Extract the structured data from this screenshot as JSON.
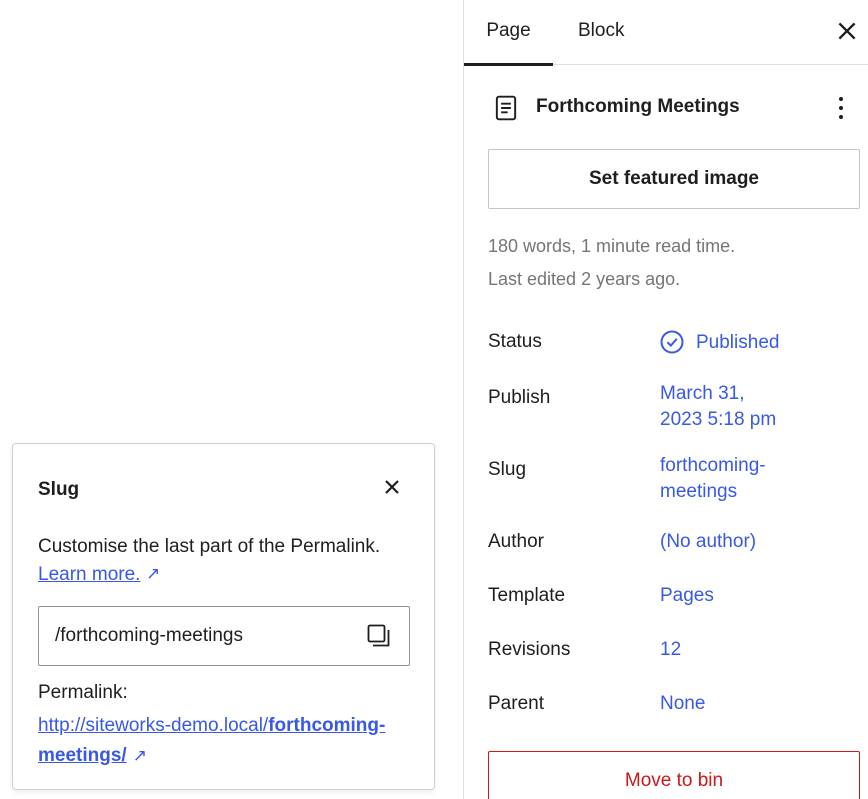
{
  "sidebar": {
    "tabs": [
      {
        "label": "Page",
        "active": true
      },
      {
        "label": "Block",
        "active": false
      }
    ],
    "close_icon": "close-icon",
    "page_title": "Forthcoming Meetings",
    "page_icon": "document-icon",
    "more_icon": "more-vertical-icon",
    "featured_image_label": "Set featured image",
    "word_count_text": "180 words, 1 minute read time.",
    "last_edited_text": "Last edited 2 years ago.",
    "rows": {
      "status": {
        "label": "Status",
        "value": "Published",
        "icon": "published-check-icon"
      },
      "publish": {
        "label": "Publish",
        "value_line1": "March 31,",
        "value_line2": "2023 5:18 pm"
      },
      "slug": {
        "label": "Slug",
        "value_line1": "forthcoming-",
        "value_line2": "meetings"
      },
      "author": {
        "label": "Author",
        "value": "(No author)"
      },
      "template": {
        "label": "Template",
        "value": "Pages"
      },
      "revisions": {
        "label": "Revisions",
        "value": "12"
      },
      "parent": {
        "label": "Parent",
        "value": "None"
      }
    },
    "move_to_bin_label": "Move to bin"
  },
  "slug_popover": {
    "title": "Slug",
    "close_icon": "close-icon",
    "description": "Customise the last part of the Permalink.",
    "learn_more": "Learn more.",
    "external_arrow": "↗",
    "input_value": "/forthcoming-meetings",
    "copy_icon": "copy-icon",
    "permalink_label": "Permalink:",
    "permalink_base": "http://siteworks-demo.local/",
    "permalink_slug_line1": "forthcoming-",
    "permalink_slug_line2": "meetings/"
  },
  "colors": {
    "accent": "#3858e9",
    "text": "#1e1e1e",
    "muted": "#757575",
    "danger": "#cc1818",
    "border": "#e0e0e0"
  }
}
